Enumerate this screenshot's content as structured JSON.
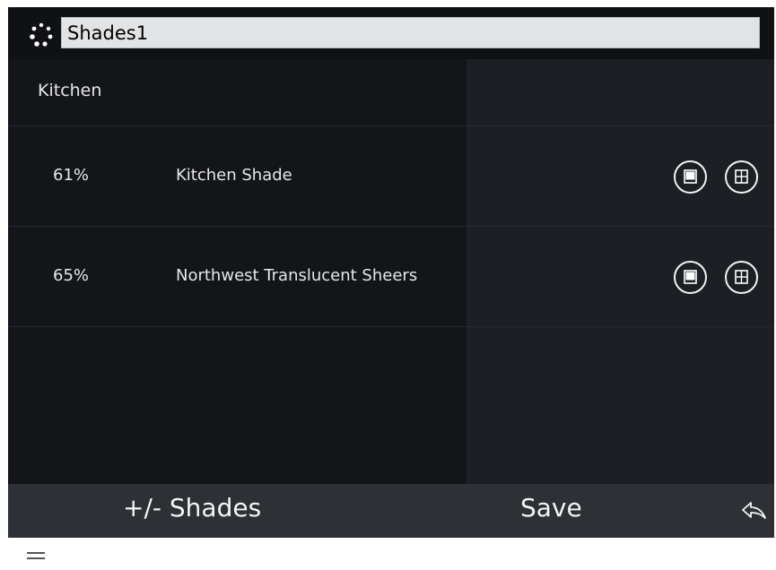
{
  "header": {
    "logo_icon": "loading-spinner-icon",
    "name_value": "Shades1"
  },
  "room": {
    "label": "Kitchen"
  },
  "shades": [
    {
      "percent": "61%",
      "name": "Kitchen Shade",
      "close_icon": "shade-closed-icon",
      "open_icon": "shade-open-window-icon"
    },
    {
      "percent": "65%",
      "name": "Northwest Translucent Sheers",
      "close_icon": "shade-closed-icon",
      "open_icon": "shade-open-window-icon"
    }
  ],
  "footer": {
    "shades_label": "+/- Shades",
    "save_label": "Save",
    "back_icon": "back-arrow-icon"
  },
  "below": {
    "menu_icon": "hamburger-menu-icon"
  },
  "colors": {
    "input_bg": "#e2e3e5",
    "panel_dark": "#131519",
    "panel_right": "#1c1f24",
    "footer_bg": "#2d3034",
    "text": "#e6e7e9"
  }
}
